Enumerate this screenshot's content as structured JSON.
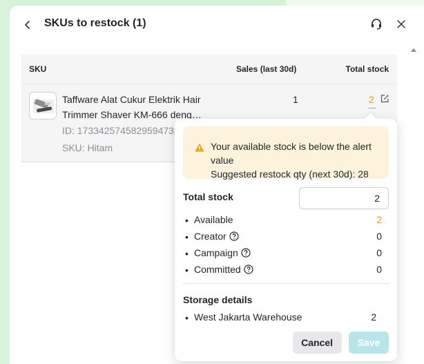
{
  "header": {
    "title": "SKUs to restock (1)"
  },
  "table": {
    "columns": {
      "sku": "SKU",
      "sales": "Sales (last 30d)",
      "stock": "Total stock"
    },
    "rows": [
      {
        "name": "Taffware Alat Cukur Elektrik Hair Trimmer Shaver KM-666 deng…",
        "id": "ID: 1733425745829594735",
        "sku": "SKU: Hitam",
        "sales": "1",
        "total_stock": "2"
      }
    ]
  },
  "popover": {
    "alert": {
      "line1": "Your available stock is below the alert value",
      "line2": "Suggested restock qty (next 30d): 28"
    },
    "total_stock_label": "Total stock",
    "total_stock_value": "2",
    "breakdown": [
      {
        "label": "Available",
        "value": "2"
      },
      {
        "label": "Creator",
        "value": "0"
      },
      {
        "label": "Campaign",
        "value": "0"
      },
      {
        "label": "Committed",
        "value": "0"
      }
    ],
    "storage_label": "Storage details",
    "warehouses": [
      {
        "label": "West Jakarta Warehouse",
        "value": "2"
      }
    ],
    "cancel_label": "Cancel",
    "save_label": "Save"
  },
  "colors": {
    "warning": "#e5a100",
    "alert_bg": "#fdf3dd",
    "save_disabled": "#b8e6e8",
    "background_green": "#d6f2d9"
  },
  "icons": [
    "chevron-left-icon",
    "headset-icon",
    "close-icon",
    "edit-icon",
    "warning-icon",
    "help-circle-icon",
    "scroll-up-arrow-icon"
  ]
}
